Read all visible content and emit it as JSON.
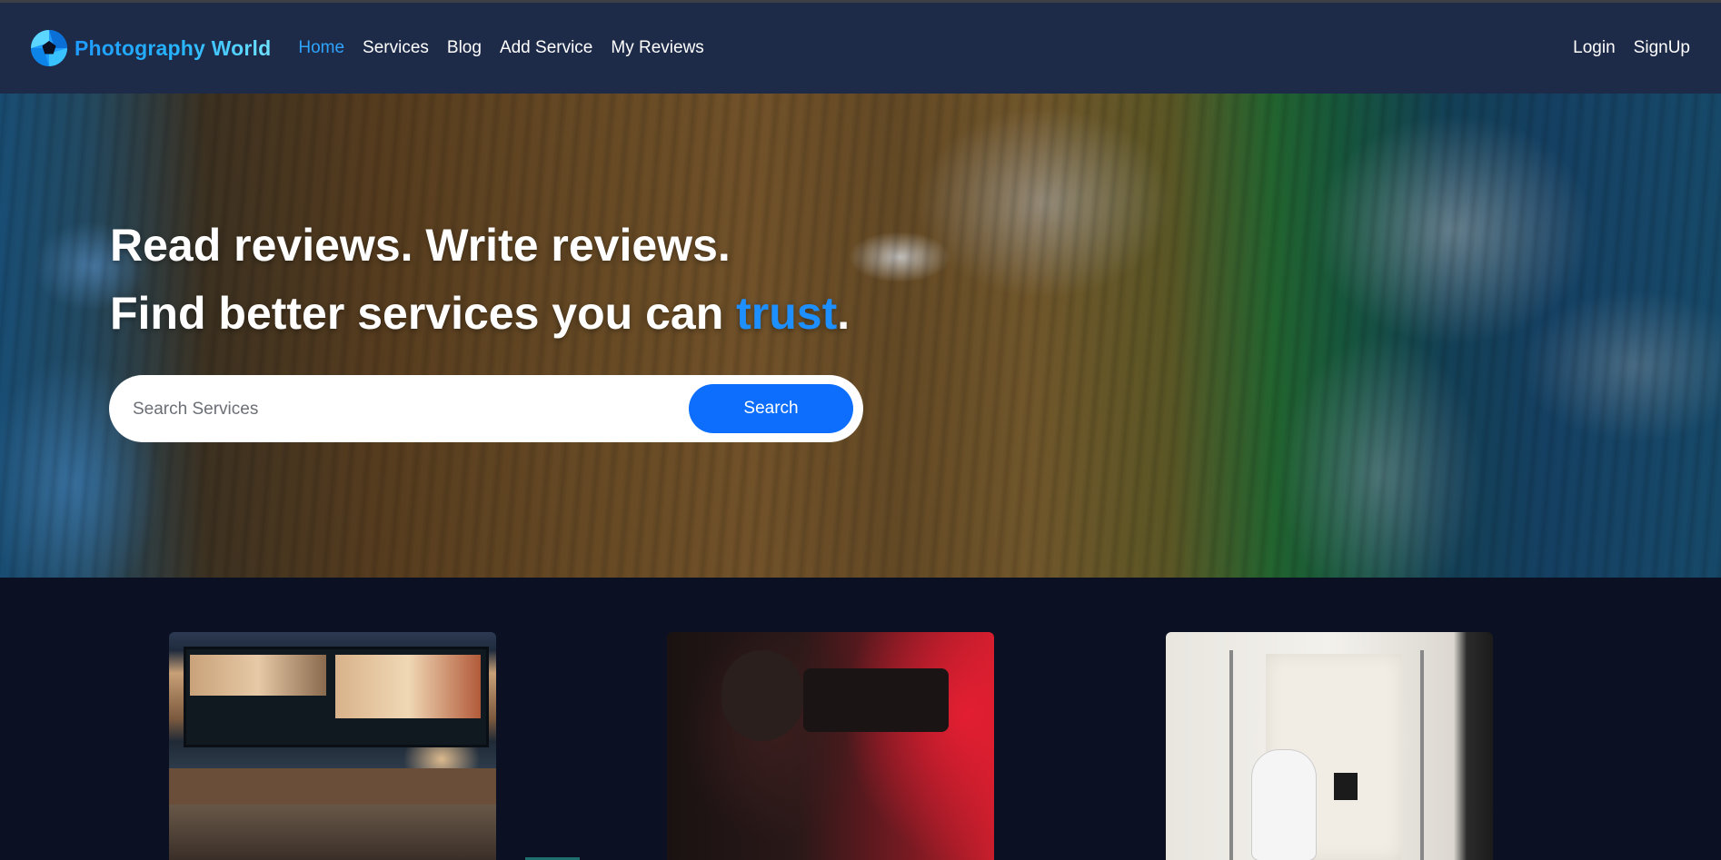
{
  "brand": {
    "name": "Photography World",
    "icon": "camera-aperture-icon",
    "gradient": [
      "#1e9bff",
      "#6fe3ff"
    ]
  },
  "nav": {
    "links": [
      "Home",
      "Services",
      "Blog",
      "Add Service",
      "My Reviews"
    ],
    "active": "Home",
    "auth": [
      "Login",
      "SignUp"
    ]
  },
  "hero": {
    "line1": "Read reviews. Write reviews.",
    "line2_prefix": "Find better services you can ",
    "line2_accent": "trust",
    "line2_suffix": ".",
    "search": {
      "placeholder": "Search Services",
      "value": "",
      "button": "Search"
    }
  },
  "cards": [
    {
      "image": "video-editing-desk-photo"
    },
    {
      "image": "videographer-red-light-photo"
    },
    {
      "image": "studio-photographer-photo"
    }
  ],
  "colors": {
    "nav_bg": "#1d2a48",
    "page_bg": "#0b1122",
    "accent": "#1e8fff",
    "button": "#0d6efd",
    "active_link": "#2fa4ff"
  }
}
